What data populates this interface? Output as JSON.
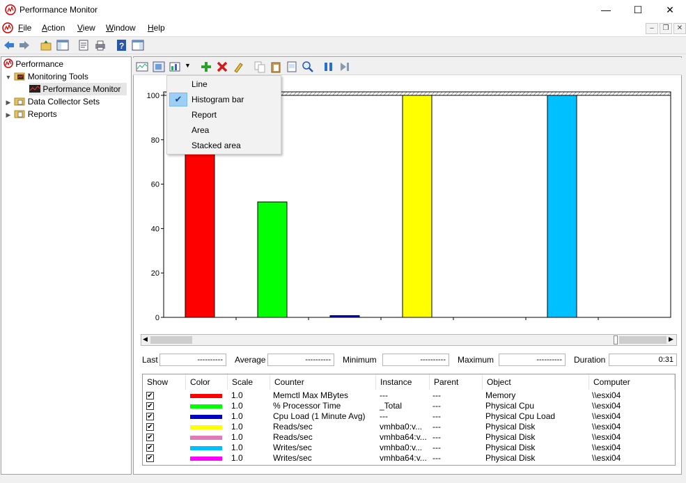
{
  "window": {
    "title": "Performance Monitor",
    "minimize": "—",
    "maximize": "☐",
    "close": "✕"
  },
  "menu": [
    "File",
    "Action",
    "View",
    "Window",
    "Help"
  ],
  "menu_underline": [
    "F",
    "A",
    "V",
    "W",
    "H"
  ],
  "tree": {
    "root": "Performance",
    "monitoring_tools": "Monitoring Tools",
    "performance_monitor": "Performance Monitor",
    "data_collector_sets": "Data Collector Sets",
    "reports": "Reports"
  },
  "graph_type_menu": {
    "items": [
      "Line",
      "Histogram bar",
      "Report",
      "Area",
      "Stacked area"
    ],
    "checked": "Histogram bar"
  },
  "stats": {
    "last_label": "Last",
    "last_value": "----------",
    "average_label": "Average",
    "average_value": "----------",
    "minimum_label": "Minimum",
    "minimum_value": "----------",
    "maximum_label": "Maximum",
    "maximum_value": "----------",
    "duration_label": "Duration",
    "duration_value": "0:31"
  },
  "chart_data": {
    "type": "bar",
    "ylim": [
      0,
      100
    ],
    "yticks": [
      "100",
      "80",
      "60",
      "40",
      "20",
      "0"
    ],
    "bars": [
      {
        "color": "#ff0000",
        "value": 100
      },
      {
        "color": "#00ff00",
        "value": 52
      },
      {
        "color": "#0000c0",
        "value": 0.8
      },
      {
        "color": "#ffff00",
        "value": 100
      },
      {
        "color": "#e07ab8",
        "value": 0
      },
      {
        "color": "#00c0ff",
        "value": 100
      },
      {
        "color": "#ff00ff",
        "value": 0
      }
    ]
  },
  "legend": {
    "headers": [
      "Show",
      "Color",
      "Scale",
      "Counter",
      "Instance",
      "Parent",
      "Object",
      "Computer"
    ],
    "rows": [
      {
        "color": "#ff0000",
        "scale": "1.0",
        "counter": "Memctl Max MBytes",
        "instance": "---",
        "parent": "---",
        "object": "Memory",
        "computer": "\\\\esxi04"
      },
      {
        "color": "#00ff00",
        "scale": "1.0",
        "counter": "% Processor Time",
        "instance": "_Total",
        "parent": "---",
        "object": "Physical Cpu",
        "computer": "\\\\esxi04"
      },
      {
        "color": "#0000c0",
        "scale": "1.0",
        "counter": "Cpu Load (1 Minute Avg)",
        "instance": "---",
        "parent": "---",
        "object": "Physical Cpu Load",
        "computer": "\\\\esxi04"
      },
      {
        "color": "#ffff00",
        "scale": "1.0",
        "counter": "Reads/sec",
        "instance": "vmhba0:v...",
        "parent": "---",
        "object": "Physical Disk",
        "computer": "\\\\esxi04"
      },
      {
        "color": "#e07ab8",
        "scale": "1.0",
        "counter": "Reads/sec",
        "instance": "vmhba64:v...",
        "parent": "---",
        "object": "Physical Disk",
        "computer": "\\\\esxi04"
      },
      {
        "color": "#00c0ff",
        "scale": "1.0",
        "counter": "Writes/sec",
        "instance": "vmhba0:v...",
        "parent": "---",
        "object": "Physical Disk",
        "computer": "\\\\esxi04"
      },
      {
        "color": "#ff00ff",
        "scale": "1.0",
        "counter": "Writes/sec",
        "instance": "vmhba64:v...",
        "parent": "---",
        "object": "Physical Disk",
        "computer": "\\\\esxi04"
      }
    ]
  }
}
